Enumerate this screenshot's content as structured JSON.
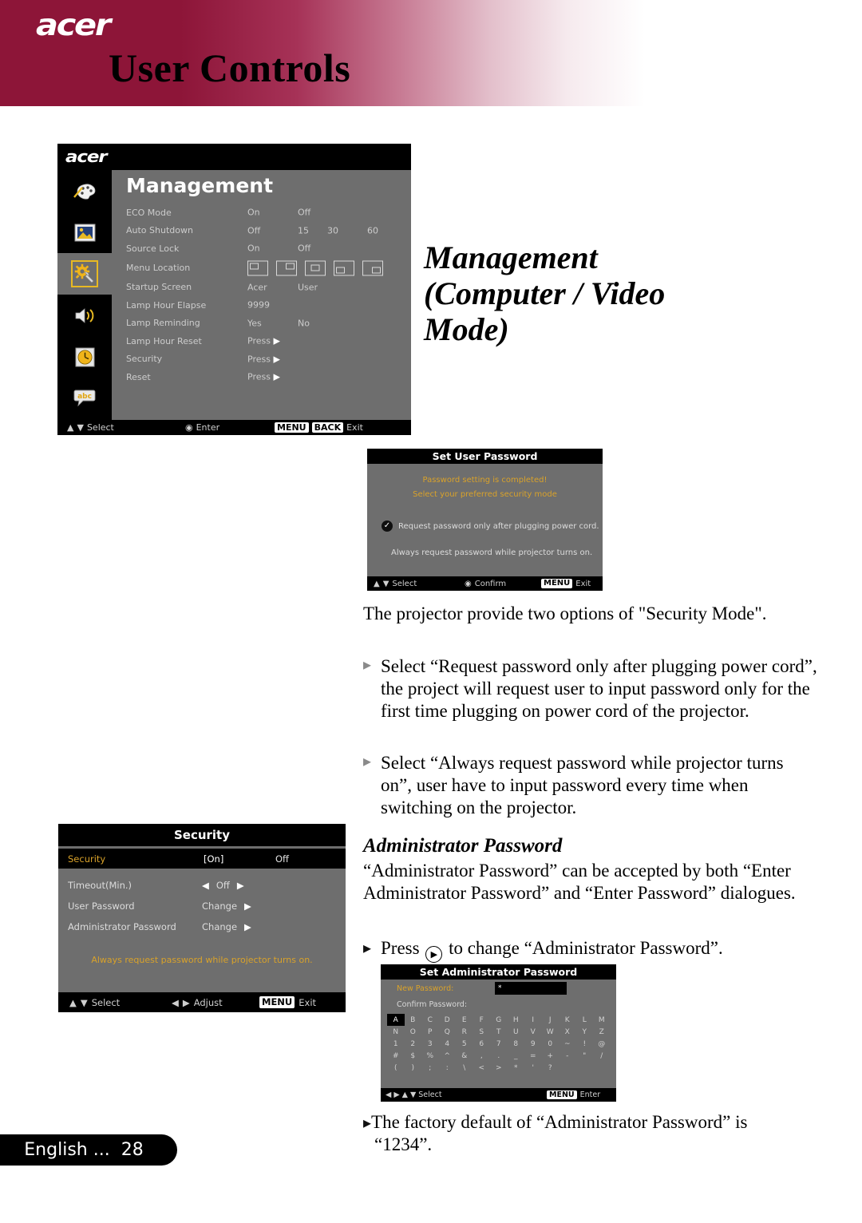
{
  "header": {
    "logo": "acer",
    "title": "User Controls"
  },
  "right_heading": {
    "line1": "Management",
    "line2": "(Computer / Video",
    "line3": "Mode)"
  },
  "management_osd": {
    "logo": "acer",
    "panel_title": "Management",
    "sidebar_icons": [
      "color-palette-icon",
      "image-icon",
      "gear-wrench-icon",
      "speaker-icon",
      "clock-icon",
      "abc-language-icon"
    ],
    "selected_sidebar_index": 2,
    "rows": [
      {
        "label": "ECO Mode",
        "values": [
          "On",
          "Off"
        ]
      },
      {
        "label": "Auto Shutdown",
        "values": [
          "Off",
          "15",
          "30",
          "60"
        ]
      },
      {
        "label": "Source Lock",
        "values": [
          "On",
          "Off"
        ]
      },
      {
        "label": "Menu Location",
        "values": []
      },
      {
        "label": "Startup Screen",
        "values": [
          "Acer",
          "User"
        ]
      },
      {
        "label": "Lamp Hour Elapse",
        "values": [
          "9999"
        ]
      },
      {
        "label": "Lamp Reminding",
        "values": [
          "Yes",
          "No"
        ]
      },
      {
        "label": "Lamp Hour Reset",
        "values": [
          "Press"
        ]
      },
      {
        "label": "Security",
        "values": [
          "Press"
        ]
      },
      {
        "label": "Reset",
        "values": [
          "Press"
        ]
      }
    ],
    "menu_locations": [
      "top-left",
      "top-right",
      "center",
      "bottom-left",
      "bottom-right"
    ],
    "footer": {
      "select": "Select",
      "enter": "Enter",
      "menu_key": "MENU",
      "back_key": "BACK",
      "exit": "Exit"
    }
  },
  "set_user_password_osd": {
    "title": "Set User Password",
    "message_line1": "Password setting is completed!",
    "message_line2": "Select your preferred security mode",
    "option1": "Request password only after plugging power cord.",
    "option2": "Always request password while projector turns on.",
    "footer": {
      "select": "Select",
      "confirm": "Confirm",
      "menu_key": "MENU",
      "exit": "Exit"
    }
  },
  "intro_paragraph": "The projector provide two options of \"Security Mode\".",
  "bullets": [
    "Select “Request password only after plugging power cord”, the project will request user to input password only for the first time plugging on power cord of the projector.",
    "Select “Always request password while projector turns on”, user have to input password every time when switching on the projector."
  ],
  "security_osd": {
    "title": "Security",
    "highlighted_row": {
      "label": "Security",
      "value_selected": "[On]",
      "value_other": "Off"
    },
    "rows": [
      {
        "label": "Timeout(Min.)",
        "value": "Off",
        "control": "left-right-adjust"
      },
      {
        "label": "User Password",
        "value": "Change",
        "control": "right-arrow"
      },
      {
        "label": "Administrator Password",
        "value": "Change",
        "control": "right-arrow"
      }
    ],
    "note": "Always request password while projector turns on.",
    "footer": {
      "select": "Select",
      "adjust": "Adjust",
      "menu_key": "MENU",
      "exit": "Exit"
    }
  },
  "admin_section": {
    "heading": "Administrator Password",
    "paragraph": "“Administrator Password” can be accepted by both “Enter Administrator Password” and “Enter Password” dialogues.",
    "bullet_before": "Press",
    "bullet_after": "to change “Administrator Password”.",
    "factory_note": "The factory default of “Administrator Password” is “1234”."
  },
  "set_admin_password_osd": {
    "title": "Set Administrator Password",
    "new_password_label": "New Password:",
    "new_password_value": "*",
    "confirm_password_label": "Confirm Password:",
    "keyboard_rows": [
      [
        "A",
        "B",
        "C",
        "D",
        "E",
        "F",
        "G",
        "H",
        "I",
        "J",
        "K",
        "L",
        "M"
      ],
      [
        "N",
        "O",
        "P",
        "Q",
        "R",
        "S",
        "T",
        "U",
        "V",
        "W",
        "X",
        "Y",
        "Z"
      ],
      [
        "1",
        "2",
        "3",
        "4",
        "5",
        "6",
        "7",
        "8",
        "9",
        "0",
        "~",
        "!",
        "@"
      ],
      [
        "#",
        "$",
        "%",
        "^",
        "&",
        ",",
        ".",
        "_",
        "=",
        "+",
        "-",
        "\"",
        "/"
      ],
      [
        "(",
        ")",
        ";",
        ":",
        "\\",
        "<",
        ">",
        "*",
        "'",
        "?"
      ]
    ],
    "selected_key": "A",
    "footer": {
      "select": "Select",
      "menu_key": "MENU",
      "enter": "Enter"
    }
  },
  "page_footer": {
    "language": "English ...",
    "page_number": "28"
  },
  "colors": {
    "brand_maroon": "#8d1538",
    "osd_gray": "#6e6e6e",
    "osd_black": "#000000",
    "amber": "#d9a22a",
    "highlight_gold": "#e8b922"
  }
}
